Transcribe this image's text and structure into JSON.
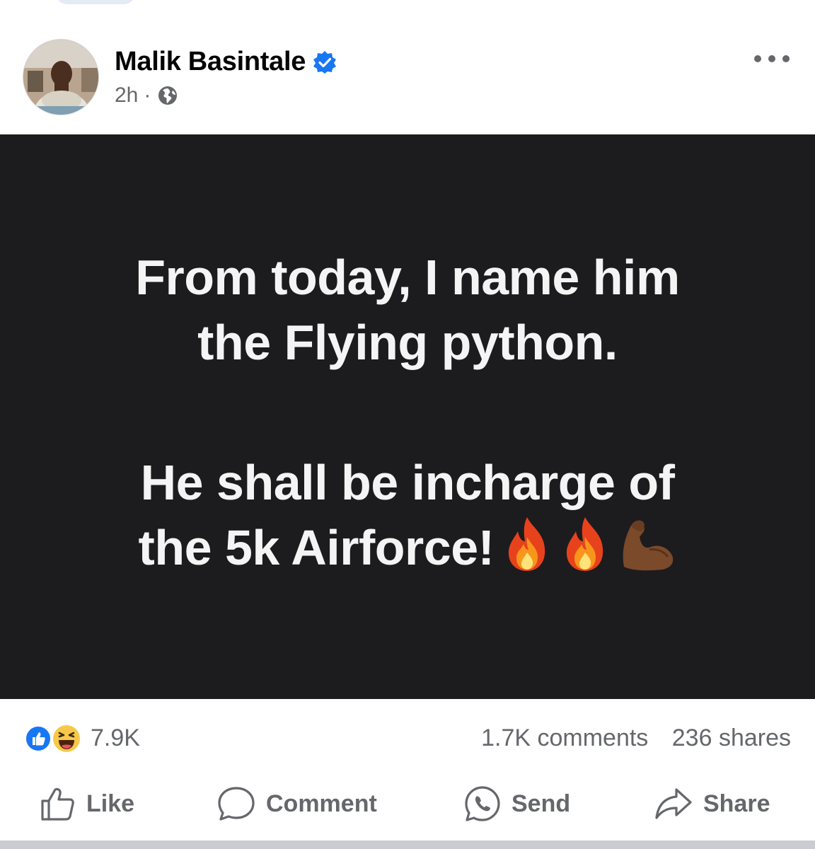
{
  "post": {
    "author": {
      "name": "Malik Basintale",
      "verified": true
    },
    "time": "2h",
    "separator": "·",
    "privacy_icon": "globe-icon",
    "more_icon": "more-options-icon",
    "body": {
      "line1": "From today, I name him",
      "line2": "the Flying python.",
      "line3": "He shall be incharge of",
      "line4": "the 5k Airforce!",
      "emojis": [
        "fire-emoji",
        "fire-emoji",
        "flexed-biceps-emoji"
      ],
      "background": "#1c1c1e",
      "text_color": "#f4f4f4"
    }
  },
  "stats": {
    "reactions": [
      "like-reaction-icon",
      "haha-reaction-icon"
    ],
    "reaction_count": "7.9K",
    "comments": "1.7K comments",
    "shares": "236 shares"
  },
  "actions": {
    "like": "Like",
    "comment": "Comment",
    "send": "Send",
    "share": "Share"
  },
  "colors": {
    "accent": "#1877f2",
    "muted": "#65676b"
  }
}
